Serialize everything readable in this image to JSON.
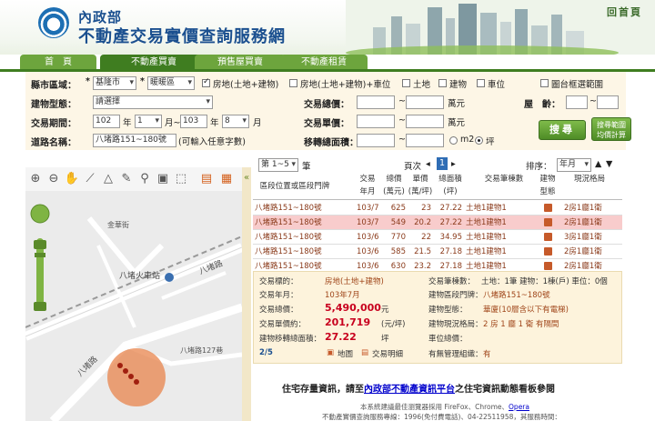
{
  "header": {
    "title_small": "內政部",
    "title_large": "不動產交易實價查詢服務網",
    "home_link": "回首頁"
  },
  "tabs": [
    {
      "label": "首　頁",
      "active": false
    },
    {
      "label": "不動產買賣",
      "active": true
    },
    {
      "label": "預售屋買賣",
      "active": false
    },
    {
      "label": "不動產租賃",
      "active": false
    }
  ],
  "search": {
    "region_label": "縣市區域：",
    "city": "基隆市",
    "district": "暖暖區",
    "asset_types": [
      {
        "label": "房地(土地+建物)",
        "checked": true
      },
      {
        "label": "房地(土地+建物)+車位",
        "checked": false
      },
      {
        "label": "土地",
        "checked": false
      },
      {
        "label": "建物",
        "checked": false
      },
      {
        "label": "車位",
        "checked": false
      }
    ],
    "map_range_label": "圖台框選範圍",
    "building_type_label": "建物型態：",
    "building_type_value": "請選擇",
    "total_price_label": "交易總價：",
    "total_price_unit": "萬元",
    "age_label": "屋　齡：",
    "period_label": "交易期間：",
    "period_from_year": "102",
    "period_from_month": "1",
    "period_to_year": "103",
    "period_to_month": "8",
    "year_unit": "年",
    "month_to_sep": "月~",
    "month_unit": "月",
    "unit_price_label": "交易單價：",
    "unit_price_unit": "萬元",
    "road_label": "道路名稱：",
    "road_value": "八堵路151~180號",
    "road_hint": "(可輸入任意字數)",
    "area_label": "移轉總面積：",
    "area_unit_m2": "m2",
    "area_unit_ping": "坪",
    "search_button": "搜尋",
    "calc_button_line1": "搜尋範圍",
    "calc_button_line2": "均價計算"
  },
  "results": {
    "page_select": "第 1~5",
    "page_unit": "筆",
    "page_label": "頁次",
    "page_num": "1",
    "sort_label": "排序：",
    "sort_value": "年月",
    "headers": [
      "區段位置或區段門牌",
      "交易年月",
      "總價(萬元)",
      "單價(萬/坪)",
      "總面積(坪)",
      "交易筆棟數",
      "建物型態",
      "現況格局"
    ],
    "rows": [
      {
        "addr": "八堵路151~180號",
        "ym": "103/7",
        "total": "625",
        "unit": "23",
        "area": "27.22",
        "parcels": "土地1建物1",
        "layout": "2房1廳1衛",
        "selected": false
      },
      {
        "addr": "八堵路151~180號",
        "ym": "103/7",
        "total": "549",
        "unit": "20.2",
        "area": "27.22",
        "parcels": "土地1建物1",
        "layout": "2房1廳1衛",
        "selected": true
      },
      {
        "addr": "八堵路151~180號",
        "ym": "103/6",
        "total": "770",
        "unit": "22",
        "area": "34.95",
        "parcels": "土地1建物1",
        "layout": "3房1廳1衛",
        "selected": false
      },
      {
        "addr": "八堵路151~180號",
        "ym": "103/6",
        "total": "585",
        "unit": "21.5",
        "area": "27.18",
        "parcels": "土地1建物1",
        "layout": "2房1廳1衛",
        "selected": false
      },
      {
        "addr": "八堵路151~180號",
        "ym": "103/6",
        "total": "630",
        "unit": "23.2",
        "area": "27.18",
        "parcels": "土地1建物1",
        "layout": "2房1廳1衛",
        "selected": false
      }
    ]
  },
  "detail": {
    "target_label": "交易標的：",
    "target_value": "房地(土地+建物)",
    "parcels_label": "交易筆棟數：",
    "parcels_value": "土地：1筆 建物：1棟(戶) 車位：0個",
    "ym_label": "交易年月：",
    "ym_value": "103年7月",
    "addr_label": "建物區段門牌：",
    "addr_value": "八堵路151~180號",
    "total_label": "交易總價：",
    "total_value": "5,490,000",
    "total_unit": "元",
    "type_label": "建物型態：",
    "type_value": "華廈(10層含以下有電梯)",
    "unit_label": "交易單價約：",
    "unit_value": "201,719",
    "unit_unit": "(元/坪)",
    "layout_label": "建物現況格局：",
    "layout_value": "2 房 1 廳 1 衛 有隔間",
    "area_label": "建物移轉總面積：",
    "area_value": "27.22",
    "area_unit": "坪",
    "parking_label": "車位總價：",
    "parking_value": "",
    "mgmt_label": "有無管理組織：",
    "mgmt_value": "有",
    "pager": "2/5",
    "map_link": "地圖",
    "detail_link": "交易明細"
  },
  "map": {
    "station_label": "八堵火車站",
    "road_label_1": "八堵路",
    "road_label_2": "八堵路",
    "alley_label": "八堵路127巷",
    "area_label": "金華街"
  },
  "footer": {
    "notice_prefix": "住宅存量資訊，請至",
    "notice_link": "內政部不動產資訊平台",
    "notice_suffix": "之住宅資訊動態看板參閱",
    "browser_text": "本系統建議最佳瀏覽器採用 FireFox、Chrome、",
    "browser_link": "Opera",
    "service_text": "不動產實價查詢服務專線：1996(免付費電話)、04-22511958，其服務時間："
  }
}
